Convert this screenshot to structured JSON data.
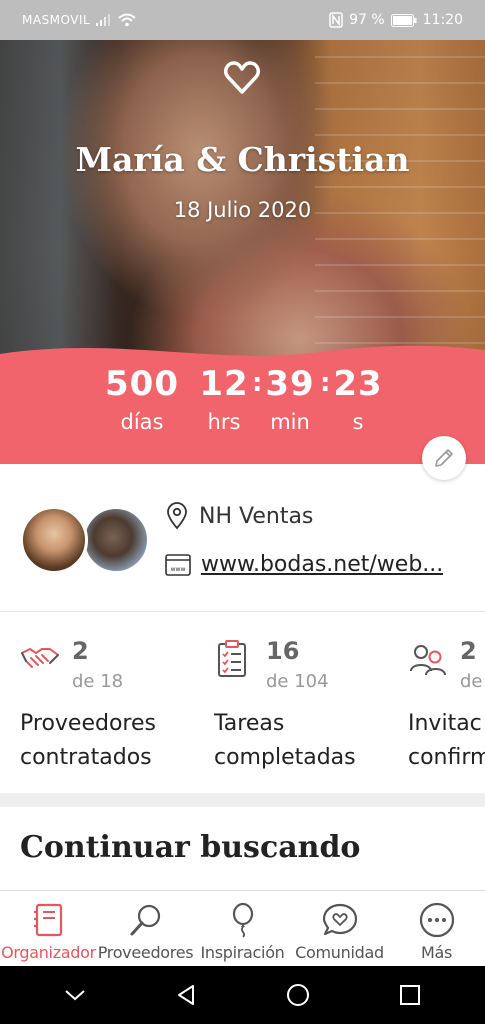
{
  "status_bar": {
    "carrier": "MASMOVIL",
    "battery": "97 %",
    "time": "11:20"
  },
  "hero": {
    "couple_names": "María & Christian",
    "wedding_date": "18 Julio 2020",
    "accent_color": "#f2646b",
    "countdown": [
      {
        "value": "500",
        "unit": "días"
      },
      {
        "value": "12",
        "unit": "hrs"
      },
      {
        "value": "39",
        "unit": "min"
      },
      {
        "value": "23",
        "unit": "s"
      }
    ]
  },
  "info": {
    "location": "NH Ventas",
    "website": "www.bodas.net/web..."
  },
  "stats": [
    {
      "icon": "handshake-icon",
      "count": "2",
      "total": "de 18",
      "label_line1": "Proveedores",
      "label_line2": "contratados"
    },
    {
      "icon": "checklist-icon",
      "count": "16",
      "total": "de 104",
      "label_line1": "Tareas",
      "label_line2": "completadas"
    },
    {
      "icon": "guests-icon",
      "count": "2",
      "total": "de",
      "label_line1": "Invitac",
      "label_line2": "confirm"
    }
  ],
  "section": {
    "title": "Continuar buscando"
  },
  "tabs": [
    {
      "icon": "notebook-icon",
      "label": "Organizador",
      "active": true
    },
    {
      "icon": "search-icon",
      "label": "Proveedores"
    },
    {
      "icon": "balloon-icon",
      "label": "Inspiración"
    },
    {
      "icon": "chat-heart-icon",
      "label": "Comunidad"
    },
    {
      "icon": "more-icon",
      "label": "Más"
    }
  ]
}
